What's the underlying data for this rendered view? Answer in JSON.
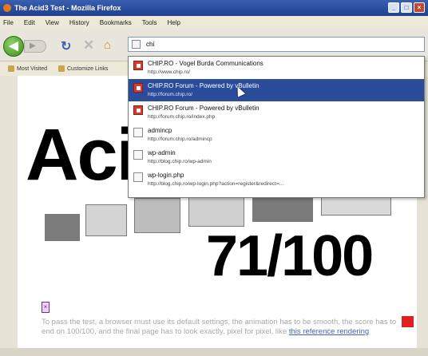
{
  "window": {
    "title": "The Acid3 Test - Mozilla Firefox",
    "controls": [
      "_",
      "□",
      "×"
    ]
  },
  "menu": [
    "File",
    "Edit",
    "View",
    "History",
    "Bookmarks",
    "Tools",
    "Help"
  ],
  "navigation": {
    "back_icon": "back-arrow-icon",
    "forward_icon": "forward-arrow-icon",
    "reload_icon": "reload-icon",
    "stop_icon": "stop-icon",
    "home_icon": "home-icon",
    "address_value": "chi"
  },
  "bookmarks": [
    "Most Visited",
    "Customize Links"
  ],
  "suggestions": [
    {
      "title": "CHIP.RO - Vogel Burda Communications",
      "url": "http://www.chip.ro/",
      "icon": "chip-favicon-icon",
      "selected": false
    },
    {
      "title": "CHIP.RO Forum - Powered by vBulletin",
      "url": "http://forum.chip.ro/",
      "icon": "chip-favicon-icon",
      "selected": true
    },
    {
      "title": "CHIP.RO Forum - Powered by vBulletin",
      "url": "http://forum.chip.ro/index.php",
      "icon": "chip-favicon-icon",
      "selected": false
    },
    {
      "title": "admincp",
      "url": "http://forum.chip.ro/admincp",
      "icon": "page-icon",
      "selected": false
    },
    {
      "title": "wp-admin",
      "url": "http://blog.chip.ro/wp-admin",
      "icon": "page-icon",
      "selected": false
    },
    {
      "title": "wp-login.php",
      "url": "http://blog.chip.ro/wp-login.php?action=register&redirect=...",
      "icon": "page-icon",
      "selected": false
    }
  ],
  "page": {
    "title": "Aci",
    "score": "71/100",
    "description": "To pass the test, a browser must use its default settings, the animation has to be smooth, the score has to end on 100/100, and the final page has to look exactly, pixel for pixel, like",
    "link": "this reference rendering",
    "colors": {
      "red_square": "#e02020",
      "selection": "#2b4c9a"
    }
  }
}
